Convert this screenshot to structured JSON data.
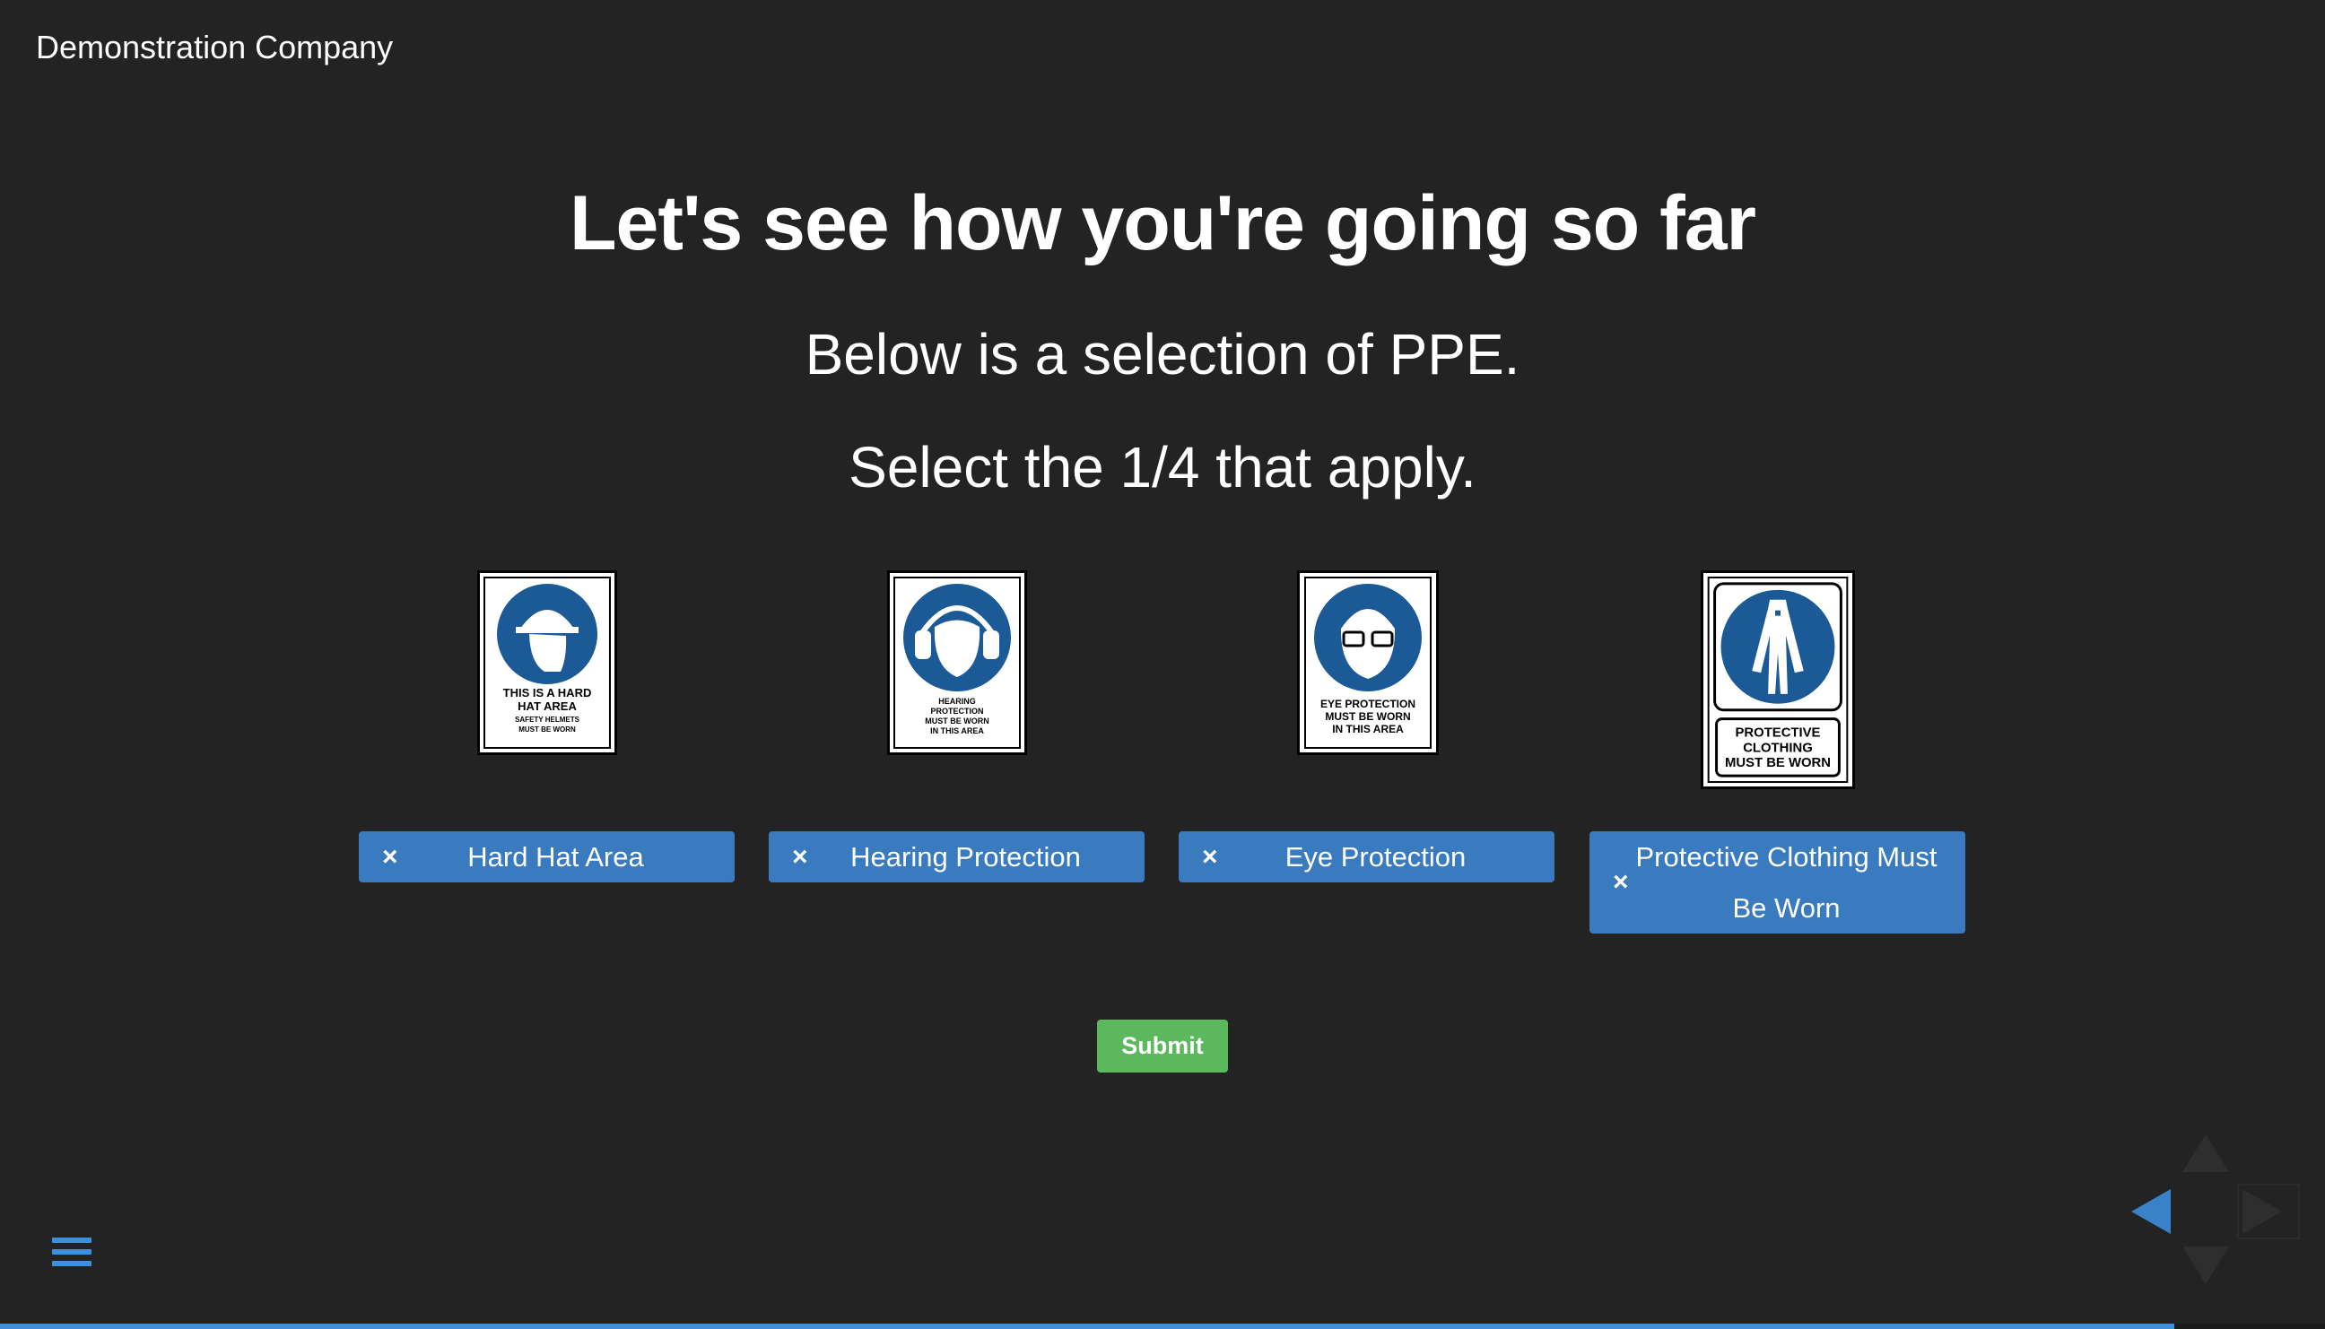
{
  "header": {
    "company": "Demonstration Company"
  },
  "main": {
    "title": "Let's see how you're going so far",
    "subtitle_1": "Below is a selection of PPE.",
    "subtitle_2": "Select the 1/4 that apply."
  },
  "signs": [
    {
      "icon": "hard-hat-sign-icon",
      "text": [
        "THIS IS A HARD",
        "HAT AREA",
        "SAFETY HELMETS",
        "MUST BE WORN"
      ]
    },
    {
      "icon": "hearing-protection-sign-icon",
      "text": [
        "HEARING",
        "PROTECTION",
        "MUST BE WORN",
        "IN THIS AREA"
      ]
    },
    {
      "icon": "eye-protection-sign-icon",
      "text": [
        "EYE PROTECTION",
        "MUST BE WORN",
        "IN THIS AREA"
      ]
    },
    {
      "icon": "protective-clothing-sign-icon",
      "text": [
        "PROTECTIVE",
        "CLOTHING",
        "MUST BE WORN"
      ]
    }
  ],
  "options": [
    {
      "remove_icon": "×",
      "label": "Hard Hat Area"
    },
    {
      "remove_icon": "×",
      "label": "Hearing Protection"
    },
    {
      "remove_icon": "×",
      "label": "Eye Protection"
    },
    {
      "remove_icon": "×",
      "label": "Protective Clothing Must Be Worn"
    }
  ],
  "submit_label": "Submit",
  "progress": 0.935,
  "colors": {
    "background": "#232323",
    "option_blue": "#3a7bbf",
    "submit_green": "#5cb85c",
    "sign_blue": "#1b5a96",
    "accent_blue": "#3d8fe0"
  }
}
